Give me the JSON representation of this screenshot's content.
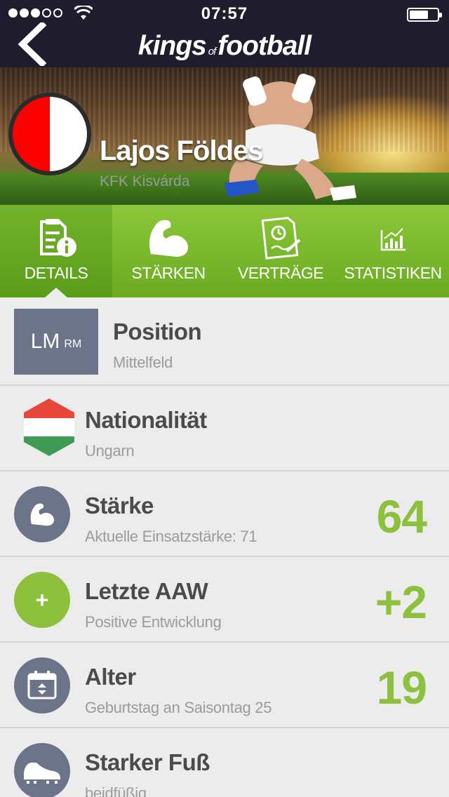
{
  "status_bar": {
    "time": "07:57",
    "signal_dots_filled": 3,
    "signal_dots_total": 5
  },
  "nav": {
    "back_icon": "chevron-left-icon",
    "logo_part1": "kings",
    "logo_part2": "of",
    "logo_part3": "football"
  },
  "player": {
    "name": "Lajos Földes",
    "club": "KFK Kisvárda",
    "club_colors": [
      "#ff0000",
      "#ffffff"
    ]
  },
  "tabs": [
    {
      "label": "DETAILS",
      "icon": "details-clipboard-icon",
      "active": true
    },
    {
      "label": "STÄRKEN",
      "icon": "flexed-arm-icon",
      "active": false
    },
    {
      "label": "VERTRÄGE",
      "icon": "contract-document-icon",
      "active": false
    },
    {
      "label": "STATISTIKEN",
      "icon": "bar-chart-icon",
      "active": false
    }
  ],
  "details": {
    "position": {
      "title": "Position",
      "sub": "Mittelfeld",
      "primary": "LM",
      "secondary": "RM"
    },
    "nationality": {
      "title": "Nationalität",
      "sub": "Ungarn",
      "flag_colors": [
        "#e8463a",
        "#ffffff",
        "#3f9a53"
      ]
    },
    "strength": {
      "title": "Stärke",
      "sub": "Aktuelle Einsatzstärke: 71",
      "value": "64",
      "icon": "flexed-arm-icon"
    },
    "last_aaw": {
      "title": "Letzte AAW",
      "sub": "Positive Entwicklung",
      "value": "+2",
      "icon_text": "+"
    },
    "age": {
      "title": "Alter",
      "sub": "Geburtstag an Saisontag 25",
      "value": "19",
      "icon": "calendar-icon"
    },
    "foot": {
      "title": "Starker Fuß",
      "sub": "beidfüßig",
      "icon": "football-boot-icon"
    }
  },
  "colors": {
    "accent_green": "#8dc13d",
    "icon_slate": "#6b7488",
    "nav_bg": "#1f1c2e"
  }
}
